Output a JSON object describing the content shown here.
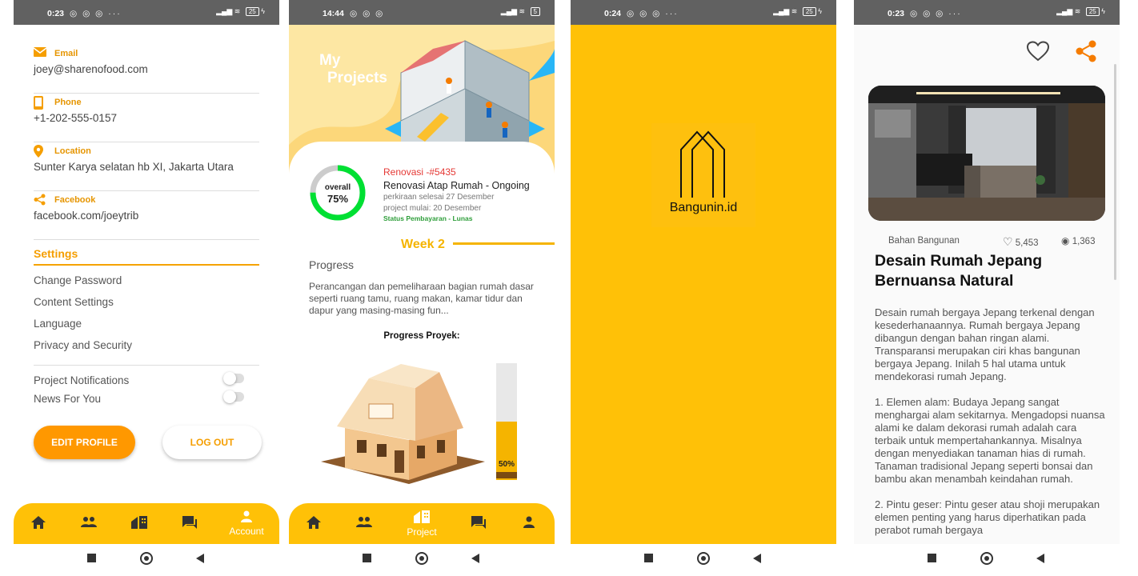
{
  "status_bars": [
    {
      "time": "0:23",
      "icons": "◎ ◎ ◎ ···",
      "battery": "25"
    },
    {
      "time": "14:44",
      "icons": "◎ ◎ ◎",
      "battery": "5"
    },
    {
      "time": "0:24",
      "icons": "◎ ◎ ◎ ···",
      "battery": "25"
    },
    {
      "time": "0:23",
      "icons": "◎ ◎ ◎ ···",
      "battery": "25"
    }
  ],
  "account": {
    "email_title": "Email",
    "email": "joey@sharenofood.com",
    "phone_title": "Phone",
    "phone": "+1-202-555-0157",
    "location_title": "Location",
    "location": "Sunter Karya selatan hb XI, Jakarta Utara",
    "facebook_title": "Facebook",
    "facebook": "facebook.com/joeytrib",
    "settings_title": "Settings",
    "settings_items": [
      "Change Password",
      "Content Settings",
      "Language",
      "Privacy and Security"
    ],
    "notifications_label": "Project Notifications",
    "news_label": "News For You",
    "notifications_on": false,
    "news_on": false,
    "edit_profile_label": "EDIT PROFILE",
    "logout_label": "LOG OUT",
    "active_tab_label": "Account"
  },
  "project": {
    "header_title_1": "My",
    "header_title_2": "Projects",
    "overall_label": "overall",
    "overall_percent_text": "75%",
    "overall_fraction": 0.75,
    "code": "Renovasi -#5435",
    "name": "Renovasi Atap Rumah  - Ongoing",
    "est_finish": "perkiraan selesai 27 Desember",
    "start": "project mulai: 20 Desember",
    "payment_status": "Status Pembayaran - Lunas",
    "week": "Week 2",
    "progress_label": "Progress",
    "description": "Perancangan dan pemeliharaan bagian rumah dasar seperti ruang tamu, ruang makan, kamar tidur dan dapur yang masing-masing fun...",
    "progress_proyek_label": "Progress Proyek:",
    "bar_percent_text": "50%",
    "bar_fraction": 0.5,
    "active_tab_label": "Project"
  },
  "splash": {
    "brand": "Bangunin.id"
  },
  "article": {
    "category": "Bahan Bangunan",
    "likes": "5,453",
    "views": "1,363",
    "title": "Desain Rumah Jepang Bernuansa Natural",
    "body": "Desain rumah bergaya Jepang terkenal dengan kesederhanaannya. Rumah bergaya Jepang dibangun dengan bahan ringan alami. Transparansi merupakan ciri khas bangunan bergaya Jepang. Inilah 5 hal utama untuk mendekorasi rumah Jepang.\n\n1. Elemen alam: Budaya Jepang sangat menghargai alam sekitarnya. Mengadopsi nuansa alami ke dalam dekorasi rumah adalah cara terbaik untuk mempertahankannya. Misalnya dengan menyediakan tanaman hias di rumah. Tanaman tradisional Jepang seperti bonsai dan bambu akan menambah keindahan rumah.\n\n2. Pintu geser: Pintu geser atau shoji merupakan elemen penting yang harus diperhatikan pada perabot rumah bergaya"
  },
  "colors": {
    "accent": "#FFC107",
    "orange": "#FF9800",
    "red": "#E53935",
    "green": "#2E9E3A",
    "ring_green": "#00E033"
  },
  "icons": {
    "tabs": [
      "home-icon",
      "people-icon",
      "project-icon",
      "chat-icon",
      "person-icon"
    ],
    "account_fields": [
      "email-icon",
      "phone-icon",
      "location-icon",
      "share-icon"
    ],
    "article_actions": [
      "heart-icon",
      "share-icon"
    ]
  }
}
